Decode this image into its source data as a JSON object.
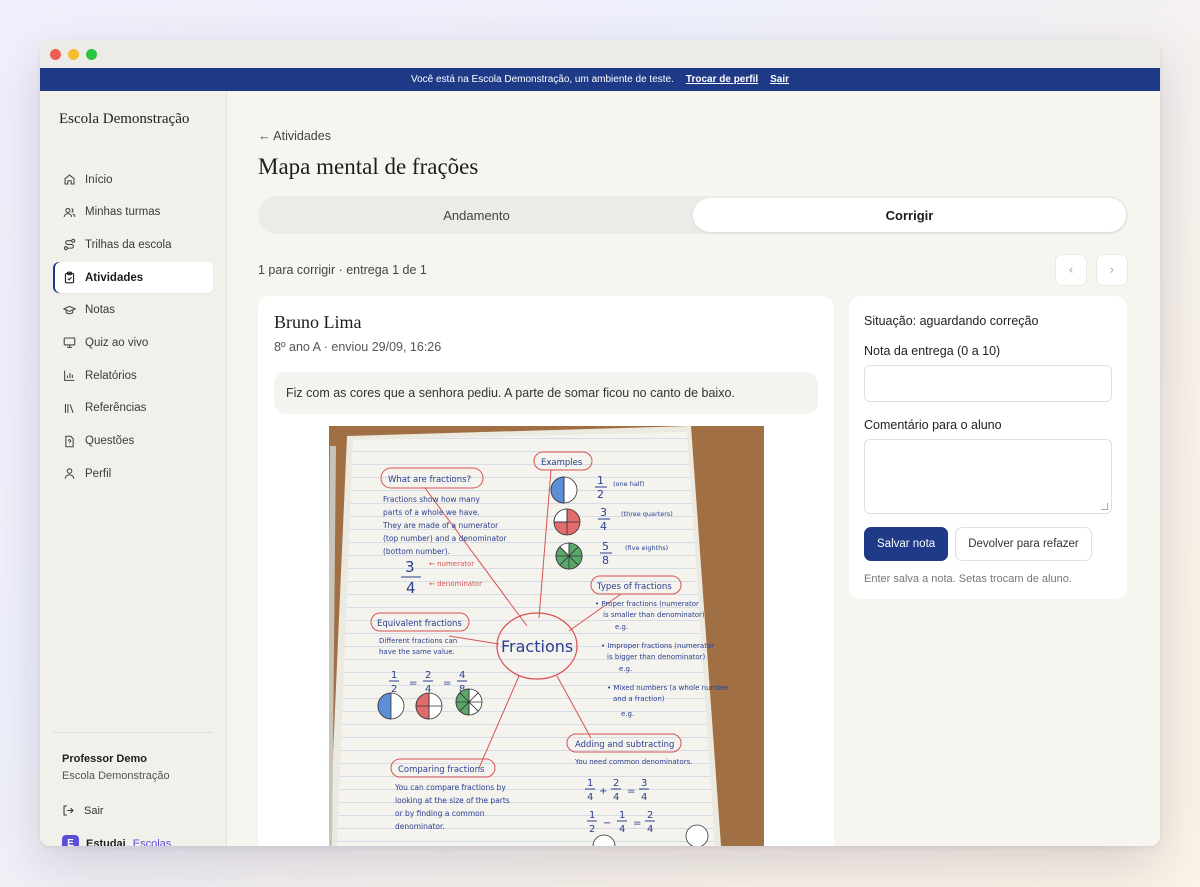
{
  "banner": {
    "text": "Você está na Escola Demonstração, um ambiente de teste.",
    "switch_profile": "Trocar de perfil",
    "exit": "Sair"
  },
  "sidebar": {
    "brand": "Escola Demonstração",
    "items": [
      {
        "label": "Início",
        "icon": "home-icon"
      },
      {
        "label": "Minhas turmas",
        "icon": "users-icon"
      },
      {
        "label": "Trilhas da escola",
        "icon": "route-icon"
      },
      {
        "label": "Atividades",
        "icon": "clipboard-icon",
        "active": true
      },
      {
        "label": "Notas",
        "icon": "graduation-cap-icon"
      },
      {
        "label": "Quiz ao vivo",
        "icon": "monitor-icon"
      },
      {
        "label": "Relatórios",
        "icon": "bar-chart-icon"
      },
      {
        "label": "Referências",
        "icon": "library-icon"
      },
      {
        "label": "Questões",
        "icon": "file-question-icon"
      },
      {
        "label": "Perfil",
        "icon": "user-icon"
      }
    ],
    "footer": {
      "name": "Professor Demo",
      "school": "Escola Demonstração",
      "logout": "Sair",
      "product_name": "Estudai",
      "product_suffix": "Escolas"
    }
  },
  "main": {
    "back_link": "← Atividades",
    "title": "Mapa mental de frações",
    "tabs": [
      {
        "label": "Andamento",
        "active": false
      },
      {
        "label": "Corrigir",
        "active": true
      }
    ],
    "progress": "1 para corrigir · entrega 1 de 1",
    "pager": {
      "prev": "‹",
      "next": "›"
    },
    "submission": {
      "student": "Bruno Lima",
      "meta": "8º ano A · enviou 29/09, 16:26",
      "message": "Fiz com as cores que a senhora pediu. A parte de somar ficou no canto de baixo."
    },
    "grading": {
      "status": "Situação: aguardando correção",
      "grade_label": "Nota da entrega (0 a 10)",
      "grade_value": "",
      "comment_label": "Comentário para o aluno",
      "comment_value": "",
      "save_button": "Salvar nota",
      "return_button": "Devolver para refazer",
      "hint": "Enter salva a nota. Setas trocam de aluno."
    }
  },
  "notebook": {
    "center": "Fractions",
    "what_title": "What are fractions?",
    "what_lines": [
      "Fractions show how many",
      "parts of a whole we have.",
      "They are made of a numerator",
      "(top number) and a denominator",
      "(bottom number)."
    ],
    "numerator_label": "← numerator",
    "denominator_label": "← denominator",
    "examples_title": "Examples",
    "ex1": "(one half)",
    "ex2": "(three quarters)",
    "ex3": "(five eighths)",
    "types_title": "Types of fractions",
    "types_lines": [
      "• Proper fractions (numerator",
      "is smaller than denominator)",
      "e.g.",
      "• Improper fractions (numerator",
      "is bigger than denominator)",
      "e.g.",
      "• Mixed numbers (a whole number",
      "and a fraction)",
      "e.g."
    ],
    "equiv_title": "Equivalent fractions",
    "equiv_lines": [
      "Different fractions can",
      "have the same value."
    ],
    "compare_title": "Comparing fractions",
    "compare_lines": [
      "You can compare fractions by",
      "looking at the size of the parts",
      "or by finding a common",
      "denominator."
    ],
    "add_title": "Adding and subtracting",
    "add_lines": [
      "You need common denominators."
    ]
  }
}
